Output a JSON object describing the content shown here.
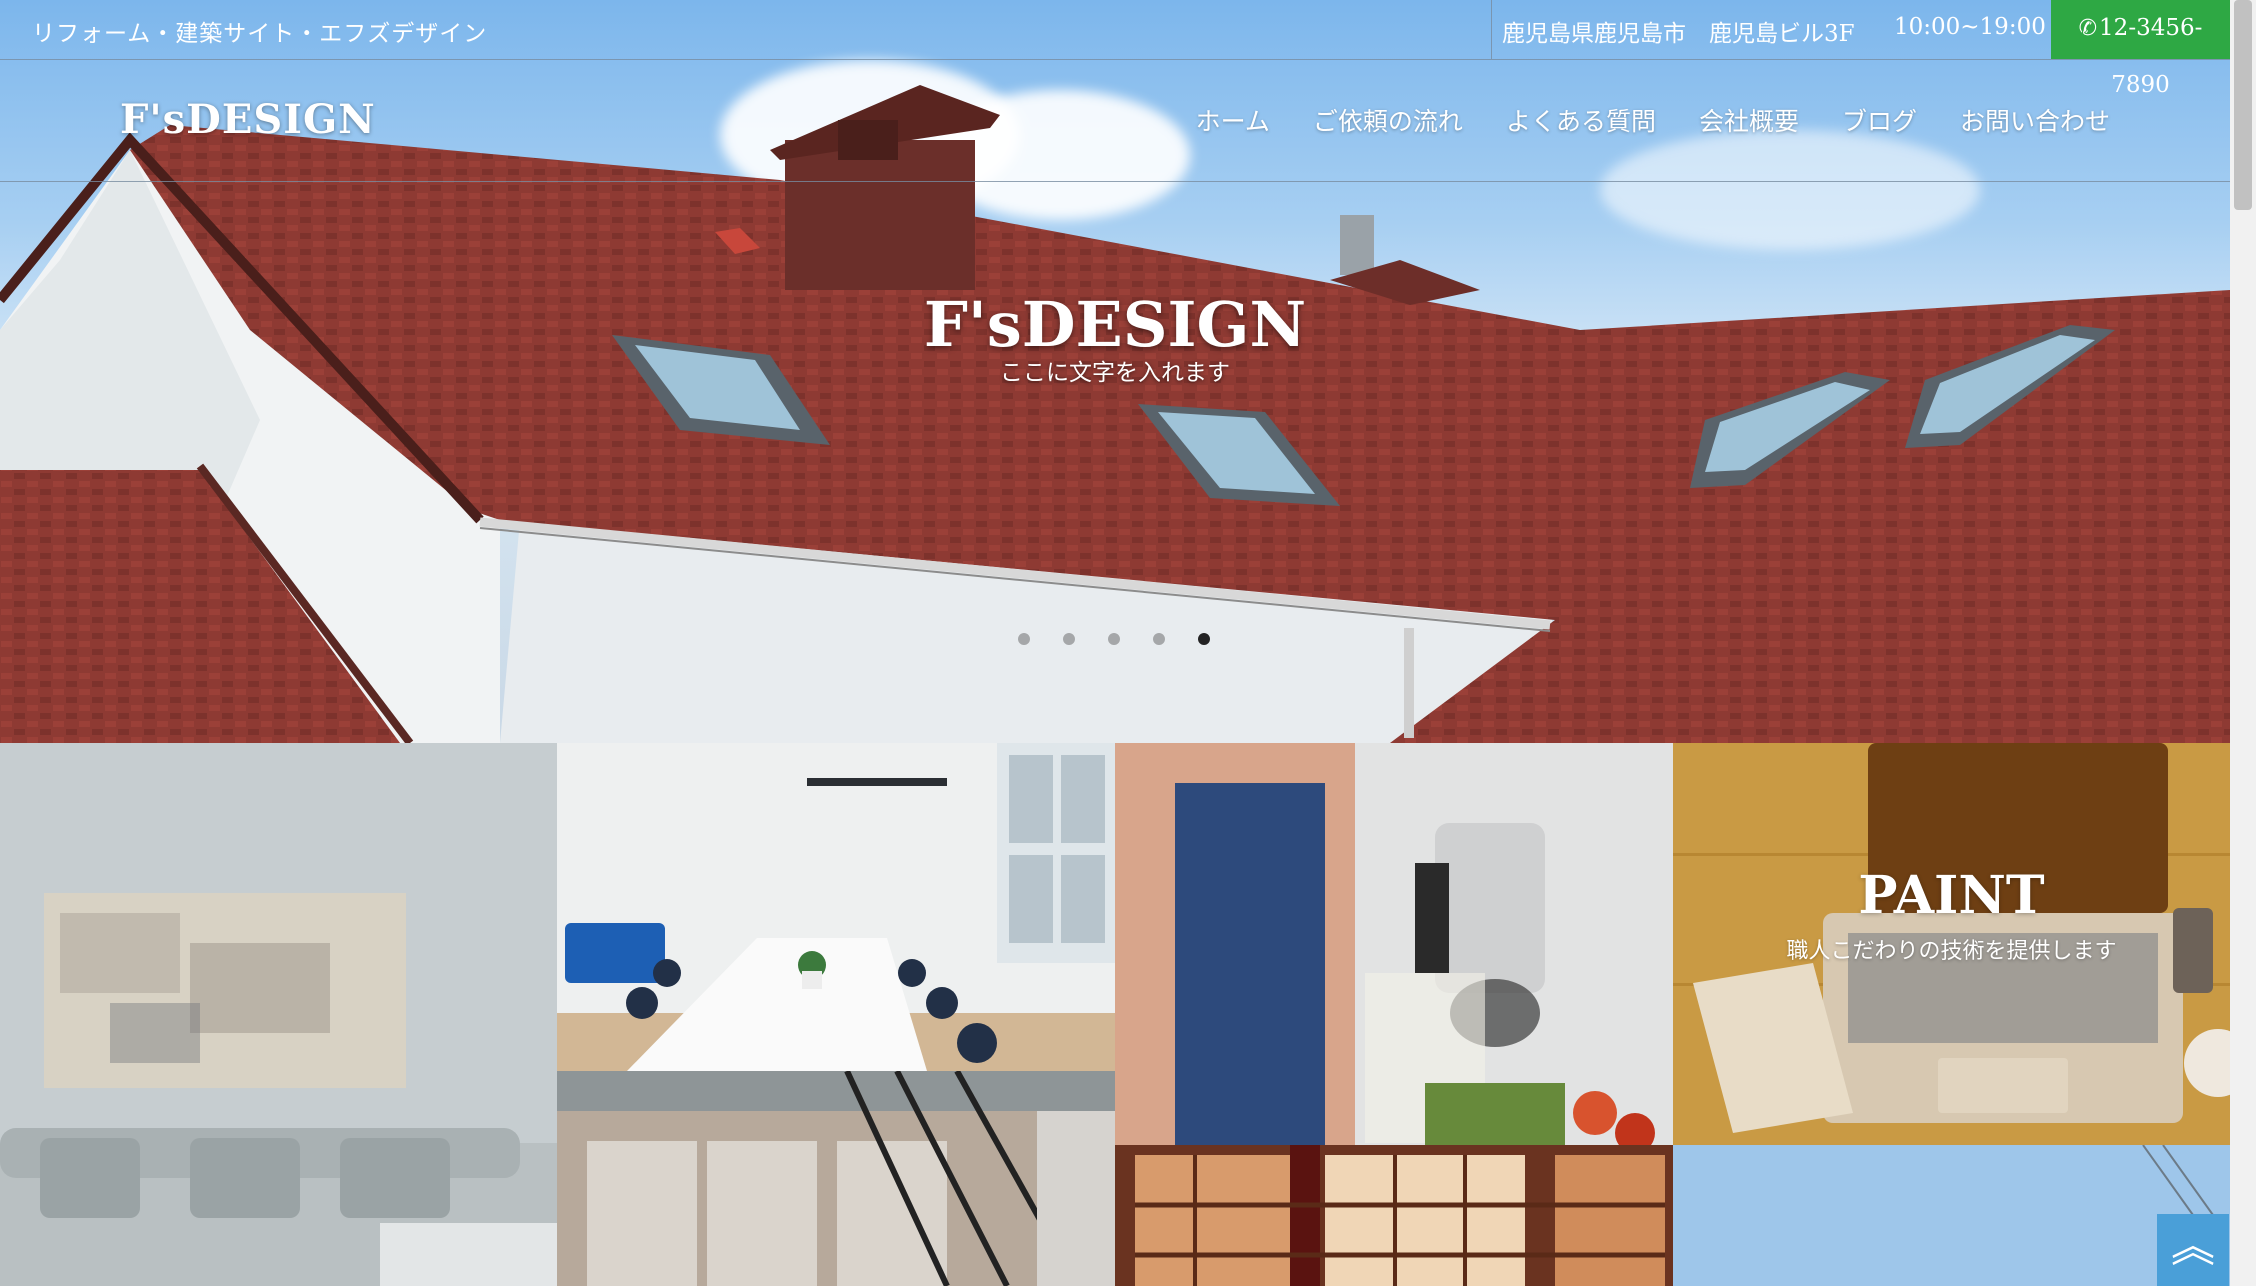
{
  "topbar": {
    "tagline": "リフォーム・建築サイト・エフズデザイン",
    "address": "鹿児島県鹿児島市　鹿児島ビル3F",
    "hours": "10:00~19:00",
    "phone": "12-3456-7890",
    "phone_icon": "phone-icon"
  },
  "header": {
    "logo": "F'sDESIGN",
    "nav": [
      "ホーム",
      "ご依頼の流れ",
      "よくある質問",
      "会社概要",
      "ブログ",
      "お問い合わせ"
    ]
  },
  "hero": {
    "title": "F'sDESIGN",
    "subtitle": "ここに文字を入れます",
    "slide_count": 5,
    "active_slide": 5
  },
  "tiles": {
    "paint_title": "PAINT",
    "paint_sub": "職人こだわりの技術を提供します"
  },
  "back_to_top_icon": "double-chevron-up-icon",
  "colors": {
    "phone_bg": "#2ea844",
    "roof": "#8e3a33",
    "back_to_top": "#4a9fd8"
  }
}
